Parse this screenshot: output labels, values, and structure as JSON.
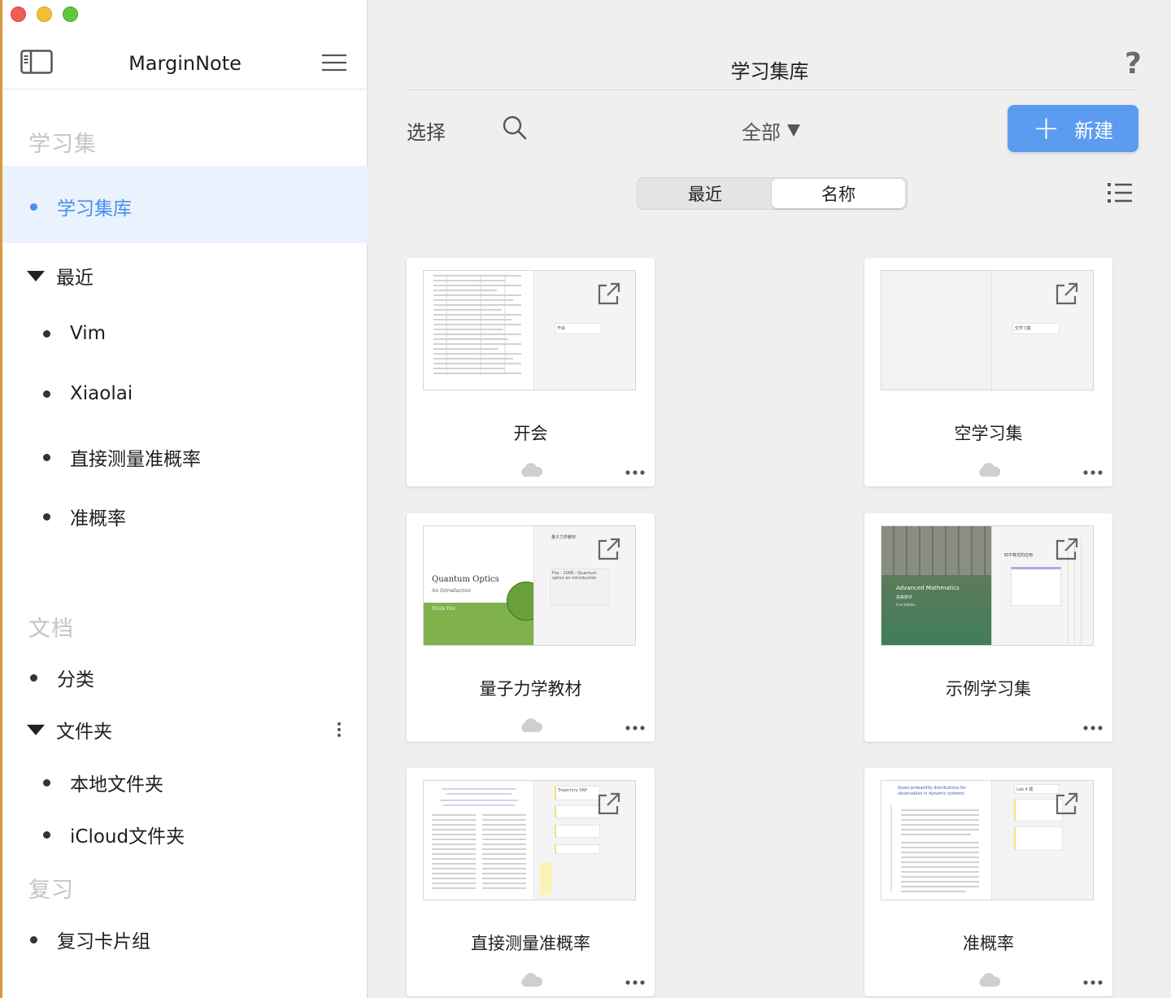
{
  "window": {
    "app_title": "MarginNote"
  },
  "sidebar": {
    "sections": {
      "study": "学习集",
      "docs": "文档",
      "review": "复习"
    },
    "study_library": "学习集库",
    "recent": {
      "label": "最近",
      "items": [
        "Vim",
        "Xiaolai",
        "直接测量准概率",
        "准概率"
      ]
    },
    "category": "分类",
    "folders": {
      "label": "文件夹",
      "items": [
        "本地文件夹",
        "iCloud文件夹"
      ]
    },
    "review_deck": "复习卡片组"
  },
  "main": {
    "title": "学习集库",
    "help": "?",
    "select_label": "选择",
    "filter_label": "全部",
    "new_label": "新建",
    "sort": {
      "recent": "最近",
      "name": "名称",
      "selected": "名称"
    },
    "cards": [
      {
        "title": "开会",
        "note": "开会"
      },
      {
        "title": "空学习集",
        "note": "空学习集"
      },
      {
        "title": "量子力学教材",
        "book": "Quantum Optics",
        "sub": "An Introduction",
        "author": "Mark Fox",
        "note_head": "量子力学教材",
        "note": "Fox - 2006 - Quantum optics an introduction"
      },
      {
        "title": "示例学习集",
        "book": "Advanced Mathmatics",
        "sub": "高等数学",
        "edition": "First Edition",
        "note_head": "四不等式的应用"
      },
      {
        "title": "直接测量准概率",
        "note_head": "Trajectory SRP"
      },
      {
        "title": "准概率",
        "paper_title": "Quasi-probability distributions for observables in dynamic systems",
        "note_head": "Lab 4 概"
      }
    ]
  },
  "colors": {
    "accent": "#4a8eec",
    "new_button": "#5b9cf0",
    "active_row": "#e9f2fd",
    "book_green": "#7fb24c"
  }
}
